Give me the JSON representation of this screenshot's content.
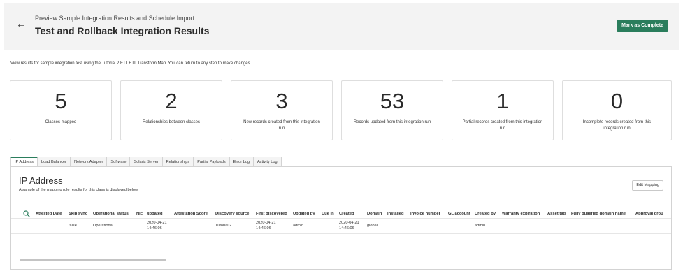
{
  "header": {
    "back_glyph": "←",
    "subtitle": "Preview Sample Integration Results and Schedule Import",
    "title": "Test and Rollback Integration Results",
    "complete_label": "Mark as Complete"
  },
  "intro": "View results for sample integration test using the Tutorial 2 ETL ETL Transform Map. You can return to any step to make changes.",
  "stats": [
    {
      "value": "5",
      "label": "Classes mapped"
    },
    {
      "value": "2",
      "label": "Relationships between classes"
    },
    {
      "value": "3",
      "label": "New records created from this integration run"
    },
    {
      "value": "53",
      "label": "Records updated from this integration run"
    },
    {
      "value": "1",
      "label": "Partial records created from this integration run"
    },
    {
      "value": "0",
      "label": "Incomplete records created from this integration run"
    }
  ],
  "tabs": [
    "IP Address",
    "Load Balancer",
    "Network Adapter",
    "Software",
    "Solaris Server",
    "Relationships",
    "Partial Payloads",
    "Error Log",
    "Activity Log"
  ],
  "panel": {
    "title": "IP Address",
    "subtitle": "A sample of the mapping rule results for this class is displayed below.",
    "edit_label": "Edit Mapping"
  },
  "table": {
    "columns": [
      "Attested Date",
      "Skip sync",
      "Operational status",
      "Nic",
      "updated",
      "Attestation Score",
      "Discovery source",
      "First discovered",
      "Updated by",
      "Due in",
      "Created",
      "Domain",
      "Installed",
      "Invoice number",
      "GL account",
      "Created by",
      "Warranty expiration",
      "Asset tag",
      "Fully qualified domain name",
      "Approval grou"
    ],
    "row": {
      "skip_sync": "false",
      "operational_status": "Operational",
      "updated_date": "2020-04-21",
      "updated_time": "14:46:06",
      "discovery_source": "Tutorial 2",
      "first_discovered_date": "2020-04-21",
      "first_discovered_time": "14:46:06",
      "updated_by": "admin",
      "created_date": "2020-04-21",
      "created_time": "14:46:06",
      "domain": "global",
      "created_by": "admin"
    }
  },
  "colors": {
    "accent": "#2a7d5c",
    "header_bg": "#f3f3f3",
    "border": "#dedede"
  }
}
